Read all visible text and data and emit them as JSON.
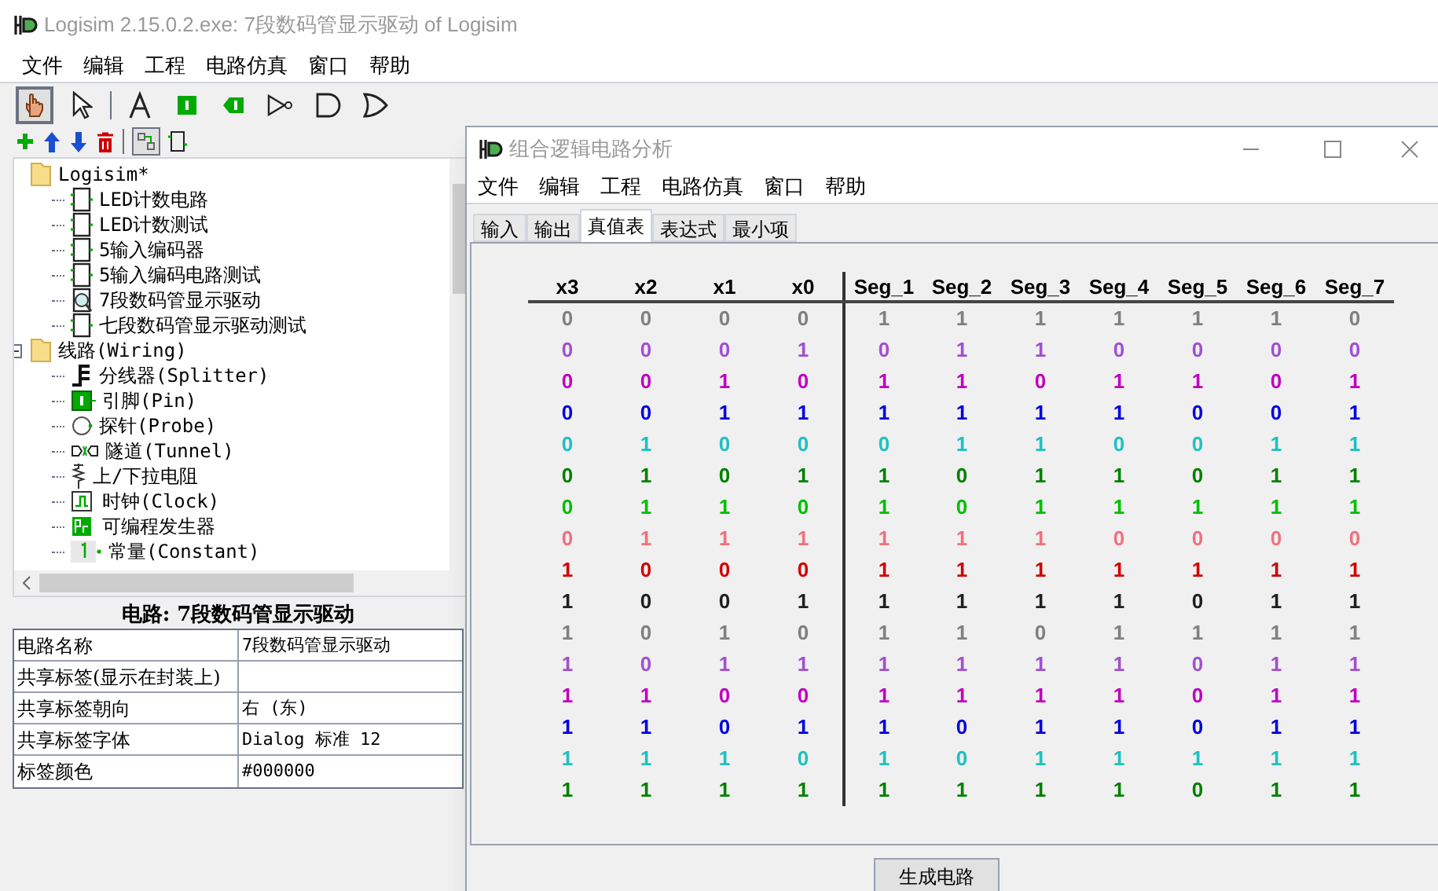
{
  "main_window": {
    "title": "Logisim 2.15.0.2.exe: 7段数码管显示驱动 of Logisim",
    "menu": [
      "文件",
      "编辑",
      "工程",
      "电路仿真",
      "窗口",
      "帮助"
    ],
    "tools": [
      {
        "kind": "hand",
        "selected": true
      },
      {
        "kind": "arrow",
        "selected": false
      },
      {
        "kind": "text",
        "selected": false
      },
      {
        "kind": "pin",
        "selected": false
      },
      {
        "kind": "probe",
        "selected": false
      },
      {
        "kind": "not",
        "selected": false
      },
      {
        "kind": "and",
        "selected": false
      },
      {
        "kind": "or",
        "selected": false
      }
    ],
    "tree": [
      {
        "label": "Logisim*",
        "kind": "folder",
        "expanded": true,
        "children": [
          {
            "label": "LED计数电路",
            "kind": "circuit"
          },
          {
            "label": "LED计数测试",
            "kind": "circuit"
          },
          {
            "label": "5输入编码器",
            "kind": "circuit"
          },
          {
            "label": "5输入编码电路测试",
            "kind": "circuit"
          },
          {
            "label": "7段数码管显示驱动",
            "kind": "current"
          },
          {
            "label": "七段数码管显示驱动测试",
            "kind": "circuit"
          }
        ]
      },
      {
        "label": "线路(Wiring)",
        "kind": "folder",
        "expanded": true,
        "children": [
          {
            "label": "分线器(Splitter)",
            "kind": "splitter"
          },
          {
            "label": "引脚(Pin)",
            "kind": "pin"
          },
          {
            "label": "探针(Probe)",
            "kind": "probe"
          },
          {
            "label": "隧道(Tunnel)",
            "kind": "tunnel"
          },
          {
            "label": "上/下拉电阻",
            "kind": "resistor"
          },
          {
            "label": "时钟(Clock)",
            "kind": "clock"
          },
          {
            "label": "可编程发生器",
            "kind": "generator"
          },
          {
            "label": "常量(Constant)",
            "kind": "constant"
          }
        ]
      }
    ],
    "properties": {
      "title": "电路: 7段数码管显示驱动",
      "rows": [
        {
          "name": "电路名称",
          "value": "7段数码管显示驱动"
        },
        {
          "name": "共享标签(显示在封装上)"
        },
        {
          "name": "共享标签朝向",
          "value": "右 (东)"
        },
        {
          "name": "共享标签字体",
          "value": "Dialog 标准 12"
        },
        {
          "name": "标签颜色",
          "value": "#000000"
        }
      ]
    }
  },
  "dialog": {
    "title": "组合逻辑电路分析",
    "menu": [
      "文件",
      "编辑",
      "工程",
      "电路仿真",
      "窗口",
      "帮助"
    ],
    "tabs": [
      {
        "label": "输入",
        "selected": false
      },
      {
        "label": "输出",
        "selected": false
      },
      {
        "label": "真值表",
        "selected": true
      },
      {
        "label": "表达式",
        "selected": false
      },
      {
        "label": "最小项",
        "selected": false
      }
    ],
    "table": {
      "inputs": [
        "x3",
        "x2",
        "x1",
        "x0"
      ],
      "outputs": [
        "Seg_1",
        "Seg_2",
        "Seg_3",
        "Seg_4",
        "Seg_5",
        "Seg_6",
        "Seg_7"
      ],
      "rows": [
        {
          "color": "#808080",
          "cells": [
            "0",
            "0",
            "0",
            "0",
            "1",
            "1",
            "1",
            "1",
            "1",
            "1",
            "0"
          ]
        },
        {
          "color": "#a050d0",
          "cells": [
            "0",
            "0",
            "0",
            "1",
            "0",
            "1",
            "1",
            "0",
            "0",
            "0",
            "0"
          ]
        },
        {
          "color": "#c000c0",
          "cells": [
            "0",
            "0",
            "1",
            "0",
            "1",
            "1",
            "0",
            "1",
            "1",
            "0",
            "1"
          ]
        },
        {
          "color": "#0000e0",
          "cells": [
            "0",
            "0",
            "1",
            "1",
            "1",
            "1",
            "1",
            "1",
            "0",
            "0",
            "1"
          ]
        },
        {
          "color": "#20c0c0",
          "cells": [
            "0",
            "1",
            "0",
            "0",
            "0",
            "1",
            "1",
            "0",
            "0",
            "1",
            "1"
          ]
        },
        {
          "color": "#008000",
          "cells": [
            "0",
            "1",
            "0",
            "1",
            "1",
            "0",
            "1",
            "1",
            "0",
            "1",
            "1"
          ]
        },
        {
          "color": "#00c000",
          "cells": [
            "0",
            "1",
            "1",
            "0",
            "1",
            "0",
            "1",
            "1",
            "1",
            "1",
            "1"
          ]
        },
        {
          "color": "#f07080",
          "cells": [
            "0",
            "1",
            "1",
            "1",
            "1",
            "1",
            "1",
            "0",
            "0",
            "0",
            "0"
          ]
        },
        {
          "color": "#d00000",
          "cells": [
            "1",
            "0",
            "0",
            "0",
            "1",
            "1",
            "1",
            "1",
            "1",
            "1",
            "1"
          ]
        },
        {
          "color": "#202020",
          "cells": [
            "1",
            "0",
            "0",
            "1",
            "1",
            "1",
            "1",
            "1",
            "0",
            "1",
            "1"
          ]
        },
        {
          "color": "#808080",
          "cells": [
            "1",
            "0",
            "1",
            "0",
            "1",
            "1",
            "0",
            "1",
            "1",
            "1",
            "1"
          ]
        },
        {
          "color": "#a050d0",
          "cells": [
            "1",
            "0",
            "1",
            "1",
            "1",
            "1",
            "1",
            "1",
            "0",
            "1",
            "1"
          ]
        },
        {
          "color": "#c000c0",
          "cells": [
            "1",
            "1",
            "0",
            "0",
            "1",
            "1",
            "1",
            "1",
            "0",
            "1",
            "1"
          ]
        },
        {
          "color": "#0000e0",
          "cells": [
            "1",
            "1",
            "0",
            "1",
            "1",
            "0",
            "1",
            "1",
            "0",
            "1",
            "1"
          ]
        },
        {
          "color": "#20c0c0",
          "cells": [
            "1",
            "1",
            "1",
            "0",
            "1",
            "0",
            "1",
            "1",
            "1",
            "1",
            "1"
          ]
        },
        {
          "color": "#008000",
          "cells": [
            "1",
            "1",
            "1",
            "1",
            "1",
            "1",
            "1",
            "1",
            "0",
            "1",
            "1"
          ]
        }
      ]
    },
    "button": "生成电路"
  }
}
